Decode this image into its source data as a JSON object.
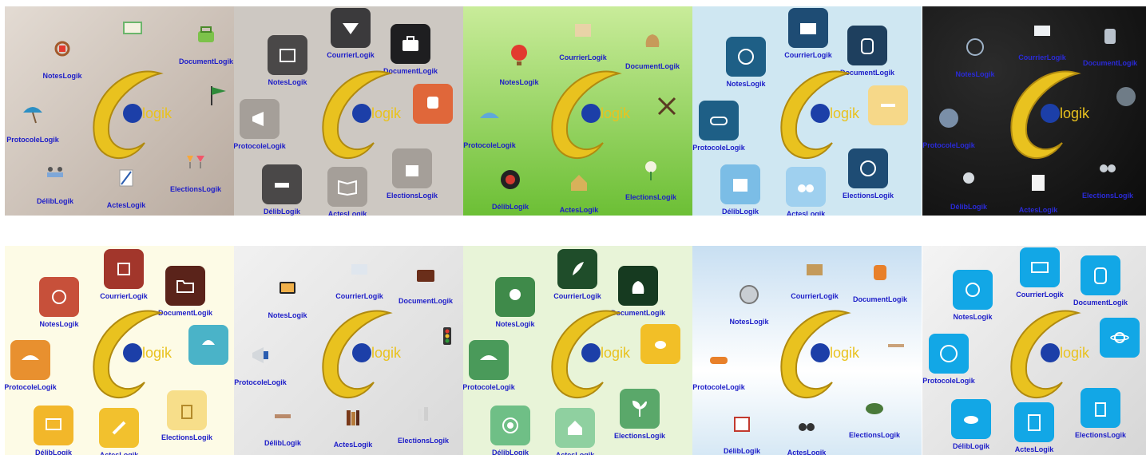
{
  "brand": {
    "mark": "C",
    "word": "logik"
  },
  "apps": [
    {
      "key": "notes",
      "label": "NotesLogik"
    },
    {
      "key": "courrier",
      "label": "CourrierLogik"
    },
    {
      "key": "document",
      "label": "DocumentLogik"
    },
    {
      "key": "protocole",
      "label": "ProtocoleLogik"
    },
    {
      "key": "delib",
      "label": "DélibLogik"
    },
    {
      "key": "actes",
      "label": "ActesLogik"
    },
    {
      "key": "elections",
      "label": "ElectionsLogik"
    },
    {
      "key": "extra",
      "label": ""
    }
  ],
  "themes": [
    {
      "name": "beach",
      "bg": "#d9cfc5",
      "bg2": "#b9ada3",
      "icon_bg": "transparent",
      "icon_fg": "#b35a2b"
    },
    {
      "name": "flat-dark",
      "bg": "#cfcbc5",
      "bg2": "#c3beb7",
      "icon_bg": "#4a4848",
      "icon_fg": "#ffffff",
      "extra_bg": "#e0673a"
    },
    {
      "name": "meadow",
      "bg": "#9ad664",
      "bg2": "#6fbf3a",
      "icon_bg": "transparent",
      "icon_fg": "#8a5a2b"
    },
    {
      "name": "sky-flat",
      "bg": "#cde6f1",
      "bg2": "#c3e0ed",
      "icon_bg": "#1e5f86",
      "icon_fg": "#ffffff",
      "extra_bg": "#f6d889"
    },
    {
      "name": "space",
      "bg": "#111111",
      "bg2": "#222222",
      "icon_bg": "transparent",
      "icon_fg": "#d8dde2"
    },
    {
      "name": "warm-flat",
      "bg": "#fdfbe7",
      "bg2": "#fbf6d8",
      "icon_bg": "#b5402e",
      "icon_fg": "#ffffff",
      "extra_bg": "#4ab3c8"
    },
    {
      "name": "cobble",
      "bg": "#ebebeb",
      "bg2": "#d7d7d7",
      "icon_bg": "transparent",
      "icon_fg": "#5a3a22"
    },
    {
      "name": "green-flat",
      "bg": "#e9f5dc",
      "bg2": "#dcefc8",
      "icon_bg": "#3a8a4a",
      "icon_fg": "#ffffff",
      "extra_bg": "#f2bf27"
    },
    {
      "name": "clouds",
      "bg": "#cfe3f3",
      "bg2": "#ffffff",
      "icon_bg": "transparent",
      "icon_fg": "#6b4a2a"
    },
    {
      "name": "blue-flat",
      "bg": "#f2f2f2",
      "bg2": "#d9d9d9",
      "icon_bg": "#12a7e6",
      "icon_fg": "#ffffff",
      "extra_bg": "#12a7e6"
    }
  ]
}
